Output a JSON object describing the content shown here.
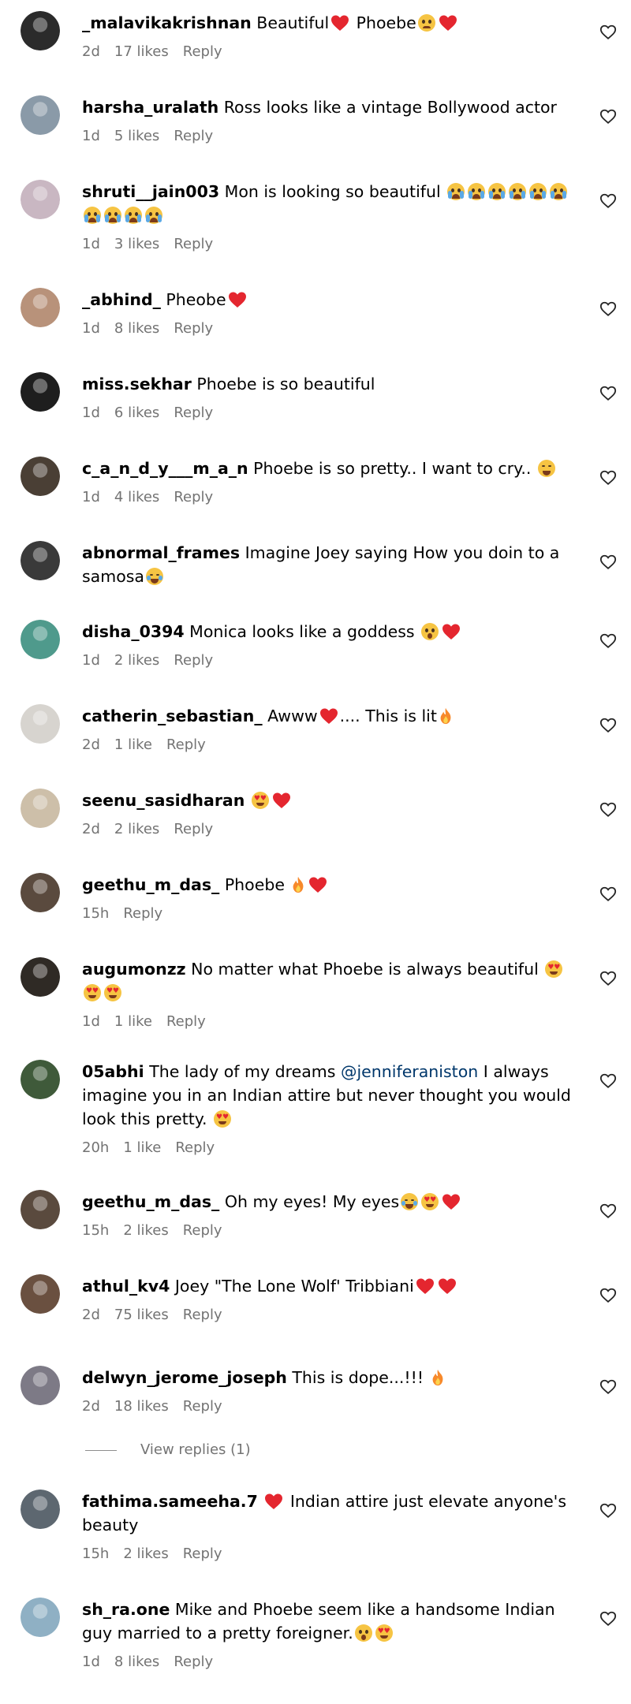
{
  "comments": [
    {
      "user": "_malavikakrishnan",
      "parts": [
        {
          "t": "text",
          "v": " Beautiful"
        },
        {
          "t": "emoji",
          "v": "red-heart"
        },
        {
          "t": "text",
          "v": " Phoebe"
        },
        {
          "t": "emoji",
          "v": "face-sad"
        },
        {
          "t": "emoji",
          "v": "red-heart"
        }
      ],
      "time": "2d",
      "likes": "17 likes",
      "reply": "Reply",
      "avatar_color": "#2b2b2b"
    },
    {
      "user": "harsha_uralath",
      "parts": [
        {
          "t": "text",
          "v": " Ross looks like a vintage Bollywood actor"
        }
      ],
      "time": "1d",
      "likes": "5 likes",
      "reply": "Reply",
      "avatar_color": "#8a9aa8"
    },
    {
      "user": "shruti__jain003",
      "parts": [
        {
          "t": "text",
          "v": " Mon is looking so beautiful "
        },
        {
          "t": "emoji",
          "v": "face-cry"
        },
        {
          "t": "emoji",
          "v": "face-cry"
        },
        {
          "t": "emoji",
          "v": "face-cry"
        },
        {
          "t": "emoji",
          "v": "face-cry"
        },
        {
          "t": "emoji",
          "v": "face-cry"
        },
        {
          "t": "emoji",
          "v": "face-cry"
        },
        {
          "t": "emoji",
          "v": "face-cry"
        },
        {
          "t": "emoji",
          "v": "face-cry"
        },
        {
          "t": "emoji",
          "v": "face-cry"
        },
        {
          "t": "emoji",
          "v": "face-cry"
        }
      ],
      "time": "1d",
      "likes": "3 likes",
      "reply": "Reply",
      "avatar_color": "#c9b7c2"
    },
    {
      "user": "_abhind_",
      "parts": [
        {
          "t": "text",
          "v": " Pheobe"
        },
        {
          "t": "emoji",
          "v": "red-heart"
        }
      ],
      "time": "1d",
      "likes": "8 likes",
      "reply": "Reply",
      "avatar_color": "#b8927a"
    },
    {
      "user": "miss.sekhar",
      "parts": [
        {
          "t": "text",
          "v": " Phoebe is so beautiful"
        }
      ],
      "time": "1d",
      "likes": "6 likes",
      "reply": "Reply",
      "avatar_color": "#1e1e1e"
    },
    {
      "user": "c_a_n_d_y___m_a_n",
      "parts": [
        {
          "t": "text",
          "v": " Phoebe is so pretty.. I want to cry.. "
        },
        {
          "t": "emoji",
          "v": "face-weary"
        }
      ],
      "time": "1d",
      "likes": "4 likes",
      "reply": "Reply",
      "avatar_color": "#4a3f35"
    },
    {
      "user": "abnormal_frames",
      "parts": [
        {
          "t": "text",
          "v": " Imagine Joey saying How you doin to a samosa"
        },
        {
          "t": "emoji",
          "v": "face-laugh"
        }
      ],
      "time": "",
      "likes": "",
      "reply": "",
      "avatar_color": "#3a3a3a"
    },
    {
      "user": "disha_0394",
      "parts": [
        {
          "t": "text",
          "v": " Monica looks like a goddess "
        },
        {
          "t": "emoji",
          "v": "face-shocked"
        },
        {
          "t": "emoji",
          "v": "red-heart"
        }
      ],
      "time": "1d",
      "likes": "2 likes",
      "reply": "Reply",
      "avatar_color": "#4f9a8c"
    },
    {
      "user": "catherin_sebastian_",
      "parts": [
        {
          "t": "text",
          "v": " Awww"
        },
        {
          "t": "emoji",
          "v": "red-heart"
        },
        {
          "t": "text",
          "v": ".... This is lit"
        },
        {
          "t": "emoji",
          "v": "fire"
        }
      ],
      "time": "2d",
      "likes": "1 like",
      "reply": "Reply",
      "avatar_color": "#d7d4cf"
    },
    {
      "user": "seenu_sasidharan",
      "parts": [
        {
          "t": "text",
          "v": " "
        },
        {
          "t": "emoji",
          "v": "face-heart-eyes"
        },
        {
          "t": "emoji",
          "v": "red-heart"
        }
      ],
      "time": "2d",
      "likes": "2 likes",
      "reply": "Reply",
      "avatar_color": "#cdbfa9"
    },
    {
      "user": "geethu_m_das_",
      "parts": [
        {
          "t": "text",
          "v": " Phoebe "
        },
        {
          "t": "emoji",
          "v": "fire"
        },
        {
          "t": "emoji",
          "v": "red-heart"
        }
      ],
      "time": "15h",
      "likes": "",
      "reply": "Reply",
      "avatar_color": "#5a4a3e"
    },
    {
      "user": "augumonzz",
      "parts": [
        {
          "t": "text",
          "v": " No matter what Phoebe is always beautiful "
        },
        {
          "t": "emoji",
          "v": "face-heart-eyes"
        },
        {
          "t": "emoji",
          "v": "face-heart-eyes"
        },
        {
          "t": "emoji",
          "v": "face-heart-eyes"
        }
      ],
      "time": "1d",
      "likes": "1 like",
      "reply": "Reply",
      "avatar_color": "#2f2a25"
    },
    {
      "user": "05abhi",
      "parts": [
        {
          "t": "text",
          "v": " The lady of my dreams "
        },
        {
          "t": "mention",
          "v": "@jenniferaniston"
        },
        {
          "t": "text",
          "v": " I always imagine you in an Indian attire but never thought you would look this pretty. "
        },
        {
          "t": "emoji",
          "v": "face-heart-eyes"
        }
      ],
      "time": "20h",
      "likes": "1 like",
      "reply": "Reply",
      "avatar_color": "#3f5a3a"
    },
    {
      "user": "geethu_m_das_",
      "parts": [
        {
          "t": "text",
          "v": " Oh my eyes! My eyes"
        },
        {
          "t": "emoji",
          "v": "face-laugh"
        },
        {
          "t": "emoji",
          "v": "face-heart-eyes"
        },
        {
          "t": "emoji",
          "v": "red-heart"
        }
      ],
      "time": "15h",
      "likes": "2 likes",
      "reply": "Reply",
      "avatar_color": "#5a4a3e"
    },
    {
      "user": "athul_kv4",
      "parts": [
        {
          "t": "text",
          "v": " Joey \"The Lone Wolf' Tribbiani"
        },
        {
          "t": "emoji",
          "v": "red-heart"
        },
        {
          "t": "emoji",
          "v": "red-heart"
        }
      ],
      "time": "2d",
      "likes": "75 likes",
      "reply": "Reply",
      "avatar_color": "#6a5040"
    },
    {
      "user": "delwyn_jerome_joseph",
      "parts": [
        {
          "t": "text",
          "v": " This is dope...!!! "
        },
        {
          "t": "emoji",
          "v": "fire"
        }
      ],
      "time": "2d",
      "likes": "18 likes",
      "reply": "Reply",
      "avatar_color": "#7d7a86"
    },
    {
      "user": "fathima.sameeha.7",
      "parts": [
        {
          "t": "text",
          "v": " "
        },
        {
          "t": "emoji",
          "v": "red-heart"
        },
        {
          "t": "text",
          "v": " Indian attire just elevate anyone's beauty"
        }
      ],
      "time": "15h",
      "likes": "2 likes",
      "reply": "Reply",
      "avatar_color": "#5d6770"
    },
    {
      "user": "sh_ra.one",
      "parts": [
        {
          "t": "text",
          "v": " Mike and Phoebe seem like a handsome Indian guy married to a pretty foreigner."
        },
        {
          "t": "emoji",
          "v": "face-shocked"
        },
        {
          "t": "emoji",
          "v": "face-heart-eyes"
        }
      ],
      "time": "1d",
      "likes": "8 likes",
      "reply": "Reply",
      "avatar_color": "#8fb0c4"
    }
  ],
  "view_replies_label": "View replies (1)",
  "icons": {
    "like": "heart-outline-icon"
  },
  "colors": {
    "meta": "#737373",
    "mention": "#00376b",
    "heart": "#e4262f"
  }
}
